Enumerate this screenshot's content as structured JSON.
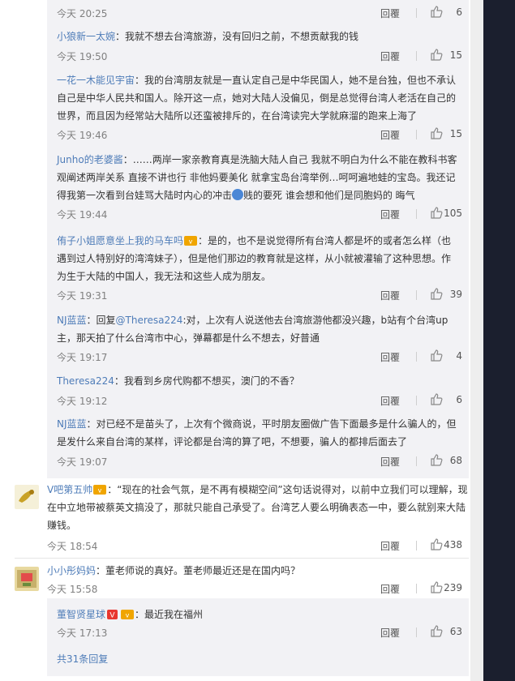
{
  "top_row": {
    "time": "今天 20:25",
    "reply": "回覆",
    "likes": "6"
  },
  "sub_comments": [
    {
      "user": "小狼新一太婉",
      "text": "：我就不想去台湾旅游，没有回归之前，不想贡献我的钱",
      "time": "今天 19:50",
      "reply": "回覆",
      "likes": "15"
    },
    {
      "user": "一花一木能见宇宙",
      "text_l1": "：我的台湾朋友就是一直认定自己是中华民国人，她不是台独，但也不承认",
      "text_l2": "自己是中华人民共和国人。除开这一点，她对大陆人没偏见，倒是总觉得台湾人老活在自己的",
      "text_l3": "世界，而且因为经常站大陆所以还蛮被排斥的，在台湾读完大学就麻溜的跑来上海了",
      "time": "今天 19:46",
      "reply": "回覆",
      "likes": "15"
    },
    {
      "user": "Junho的老婆酱",
      "text_l1": "：……两岸一家亲教育真是洗脑大陆人自己  我就不明白为什么不能在教科书客",
      "text_l2": "观阐述两岸关系 直接不讲也行 非他妈要美化 就拿宝岛台湾举例…呵呵遍地蛙的宝岛。我还记",
      "text_l3a": "得我第一次看到台娃骂大陆时内心的冲击",
      "text_l3b": "贱的要死 谁会想和他们是同胞妈的 晦气",
      "time": "今天 19:44",
      "reply": "回覆",
      "likes": "105"
    },
    {
      "user": "侑子小姐愿意坐上我的马车吗",
      "text_l1": "：是的，也不是说觉得所有台湾人都是坏的或者怎么样（也",
      "text_l2": "遇到过人特别好的湾湾妹子），但是他们那边的教育就是这样，从小就被灌输了这种思想。作",
      "text_l3": "为生于大陆的中国人，我无法和这些人成为朋友。",
      "time": "今天 19:31",
      "reply": "回覆",
      "likes": "39"
    },
    {
      "user": "NJ蓝蓝",
      "text_pre": "：回复",
      "mention": "@Theresa224",
      "text_l1": ":对，上次有人说送他去台湾旅游他都没兴趣，b站有个台湾up",
      "text_l2": "主，那天拍了什么台湾市中心，弹幕都是什么不想去，好普通",
      "time": "今天 19:17",
      "reply": "回覆",
      "likes": "4"
    },
    {
      "user": "Theresa224",
      "text": "：我看到乡房代购都不想买，澳门的不香？",
      "time": "今天 19:12",
      "reply": "回覆",
      "likes": "6"
    },
    {
      "user": "NJ蓝蓝",
      "text_l1": "：对已经不是苗头了，上次有个微商说，平时朋友圈做广告下面最多是什么骗人的，但",
      "text_l2": "是发什么来自台湾的某样，评论都是台湾的算了吧，不想要，骗人的都排后面去了",
      "time": "今天 19:07",
      "reply": "回覆",
      "likes": "68"
    }
  ],
  "main_comments": [
    {
      "user": "V吧第五帅",
      "text_l1": "：“现在的社会气氛，是不再有模糊空间”这句话说得对，以前中立我们可以理解，现",
      "text_l2": "在中立地带被蔡英文搞没了，那就只能自己承受了。台湾艺人要么明确表态一中，要么就别来大陆",
      "text_l3": "赚钱。",
      "time": "今天 18:54",
      "reply": "回覆",
      "likes": "438"
    },
    {
      "user": "小小彤妈妈",
      "text": "：董老师说的真好。董老师最近还是在国内吗？",
      "time": "今天 15:58",
      "reply": "回覆",
      "likes": "239"
    }
  ],
  "nested_reply": {
    "user": "董智贤星球",
    "text": "：最近我在福州",
    "time": "今天 17:13",
    "reply": "回覆",
    "likes": "63"
  },
  "more_replies": "共31条回复",
  "colors": {
    "link": "#4e7cb8",
    "sidebar": "#1b1f2e",
    "reply_bg": "#f2f2f5",
    "vip_red": "#e8362f",
    "vip_gold": "#f0a500"
  }
}
